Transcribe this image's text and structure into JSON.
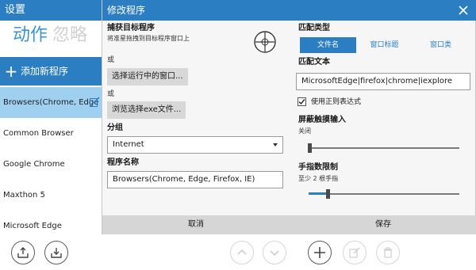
{
  "window": {
    "title": "设置"
  },
  "tabs": [
    {
      "label": "动作",
      "active": true
    },
    {
      "label": "忽略",
      "active": false
    }
  ],
  "add_program_label": "添加新程序",
  "app_list": [
    {
      "name": "Browsers(Chrome, Edge",
      "selected": true
    },
    {
      "name": "Common Browser",
      "selected": false
    },
    {
      "name": "Google Chrome",
      "selected": false
    },
    {
      "name": "Maxthon 5",
      "selected": false
    },
    {
      "name": "Microsoft Edge",
      "selected": false
    }
  ],
  "modal": {
    "title": "修改程序",
    "capture_target": {
      "label": "捕获目标程序",
      "hint": "将准星拖拽到目标程序窗口上"
    },
    "or_1": "或",
    "select_running_window_button": "选择运行中的窗口...",
    "or_2": "或",
    "browse_exe_button": "浏览选择exe文件...",
    "group": {
      "label": "分组",
      "value": "Internet"
    },
    "program_name": {
      "label": "程序名称",
      "value": "Browsers(Chrome, Edge, Firefox, IE)"
    },
    "match_type": {
      "label": "匹配类型",
      "options": [
        "文件名",
        "窗口标题",
        "窗口类"
      ],
      "selected_index": 0
    },
    "match_text": {
      "label": "匹配文本",
      "value": "MicrosoftEdge|firefox|chrome|iexplore"
    },
    "use_regex": {
      "label": "使用正则表达式",
      "checked": true
    },
    "screen_touch": {
      "label": "屏蔽触摸输入",
      "value_text": "关闭",
      "level": 0.0
    },
    "finger_limit": {
      "label": "手指数限制",
      "value_text": "至少 2 根手指",
      "level": 0.12
    },
    "cancel_button": "取消",
    "save_button": "保存"
  },
  "colors": {
    "accent": "#2b7ec2",
    "selected_row": "#9fd0f0",
    "modal_bg": "#f6f6f6",
    "footer_bg": "#d6d6d6"
  },
  "icons": [
    "crosshair-icon",
    "close-icon",
    "edit-icon",
    "export-icon",
    "import-icon",
    "move-up-icon",
    "move-down-icon",
    "add-icon",
    "edit-icon",
    "delete-icon",
    "checkmark-icon",
    "plus-icon"
  ]
}
